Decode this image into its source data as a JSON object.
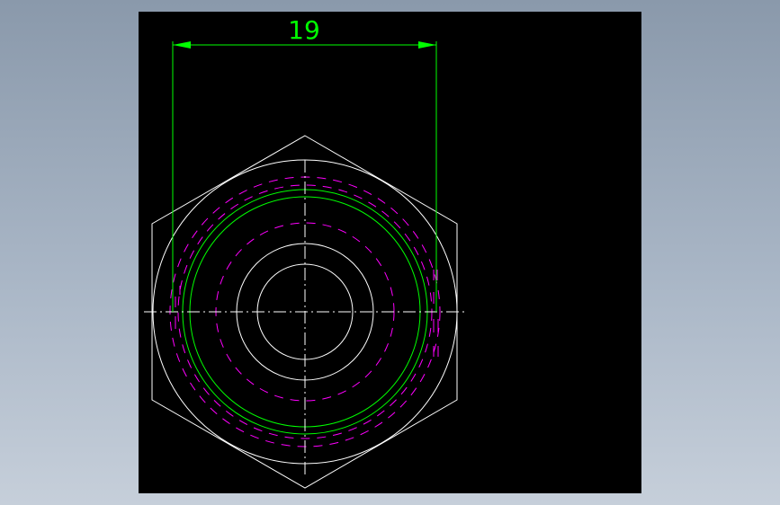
{
  "drawing": {
    "dimension_value": "19",
    "colors": {
      "background": "#000000",
      "geometry": "#ffffff",
      "dimension": "#00ff00",
      "thread_hidden": "#ff00ff",
      "centerline": "#ffffff"
    }
  }
}
